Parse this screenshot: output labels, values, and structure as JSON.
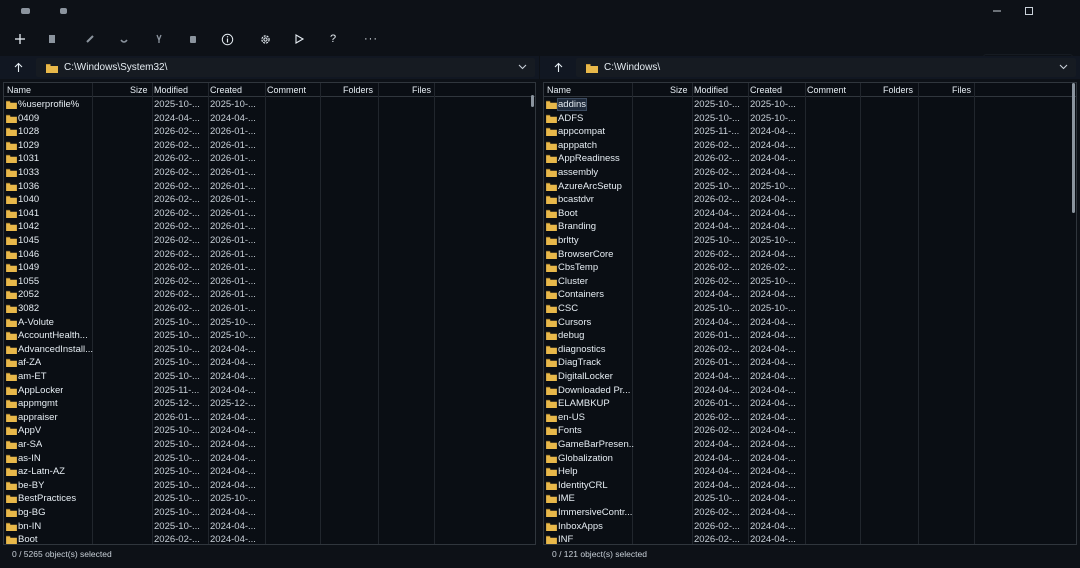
{
  "toolbar": {
    "items": [
      {
        "name": "new-icon",
        "glyph": "+"
      },
      {
        "name": "copy-icon",
        "glyph": "copy"
      },
      {
        "name": "edit-icon",
        "glyph": "edit"
      },
      {
        "name": "link-icon",
        "glyph": "link"
      },
      {
        "name": "cut-icon",
        "glyph": "cut"
      },
      {
        "name": "delete-icon",
        "glyph": "delete"
      },
      {
        "name": "info-icon",
        "glyph": "info"
      },
      {
        "name": "gear-icon",
        "glyph": "gear"
      },
      {
        "name": "play-icon",
        "glyph": "play"
      },
      {
        "name": "help-icon",
        "glyph": "?"
      },
      {
        "name": "more-icon",
        "glyph": "..."
      }
    ]
  },
  "left": {
    "path": "C:\\Windows\\System32\\",
    "columns": [
      "Name",
      "Size",
      "Modified",
      "Created",
      "Comment",
      "Folders",
      "Files"
    ],
    "rows": [
      {
        "name": "%userprofile%",
        "modified": "2025-10-...",
        "created": "2025-10-..."
      },
      {
        "name": "0409",
        "modified": "2024-04-...",
        "created": "2024-04-..."
      },
      {
        "name": "1028",
        "modified": "2026-02-...",
        "created": "2026-01-..."
      },
      {
        "name": "1029",
        "modified": "2026-02-...",
        "created": "2026-01-..."
      },
      {
        "name": "1031",
        "modified": "2026-02-...",
        "created": "2026-01-..."
      },
      {
        "name": "1033",
        "modified": "2026-02-...",
        "created": "2026-01-..."
      },
      {
        "name": "1036",
        "modified": "2026-02-...",
        "created": "2026-01-..."
      },
      {
        "name": "1040",
        "modified": "2026-02-...",
        "created": "2026-01-..."
      },
      {
        "name": "1041",
        "modified": "2026-02-...",
        "created": "2026-01-..."
      },
      {
        "name": "1042",
        "modified": "2026-02-...",
        "created": "2026-01-..."
      },
      {
        "name": "1045",
        "modified": "2026-02-...",
        "created": "2026-01-..."
      },
      {
        "name": "1046",
        "modified": "2026-02-...",
        "created": "2026-01-..."
      },
      {
        "name": "1049",
        "modified": "2026-02-...",
        "created": "2026-01-..."
      },
      {
        "name": "1055",
        "modified": "2026-02-...",
        "created": "2026-01-..."
      },
      {
        "name": "2052",
        "modified": "2026-02-...",
        "created": "2026-01-..."
      },
      {
        "name": "3082",
        "modified": "2026-02-...",
        "created": "2026-01-..."
      },
      {
        "name": "A-Volute",
        "modified": "2025-10-...",
        "created": "2025-10-..."
      },
      {
        "name": "AccountHealth...",
        "modified": "2025-10-...",
        "created": "2025-10-..."
      },
      {
        "name": "AdvancedInstall...",
        "modified": "2025-10-...",
        "created": "2024-04-..."
      },
      {
        "name": "af-ZA",
        "modified": "2025-10-...",
        "created": "2024-04-..."
      },
      {
        "name": "am-ET",
        "modified": "2025-10-...",
        "created": "2024-04-..."
      },
      {
        "name": "AppLocker",
        "modified": "2025-11-...",
        "created": "2024-04-..."
      },
      {
        "name": "appmgmt",
        "modified": "2025-12-...",
        "created": "2025-12-..."
      },
      {
        "name": "appraiser",
        "modified": "2026-01-...",
        "created": "2024-04-..."
      },
      {
        "name": "AppV",
        "modified": "2025-10-...",
        "created": "2024-04-..."
      },
      {
        "name": "ar-SA",
        "modified": "2025-10-...",
        "created": "2024-04-..."
      },
      {
        "name": "as-IN",
        "modified": "2025-10-...",
        "created": "2024-04-..."
      },
      {
        "name": "az-Latn-AZ",
        "modified": "2025-10-...",
        "created": "2024-04-..."
      },
      {
        "name": "be-BY",
        "modified": "2025-10-...",
        "created": "2024-04-..."
      },
      {
        "name": "BestPractices",
        "modified": "2025-10-...",
        "created": "2025-10-..."
      },
      {
        "name": "bg-BG",
        "modified": "2025-10-...",
        "created": "2024-04-..."
      },
      {
        "name": "bn-IN",
        "modified": "2025-10-...",
        "created": "2024-04-..."
      },
      {
        "name": "Boot",
        "modified": "2026-02-...",
        "created": "2024-04-..."
      }
    ],
    "status": "0 / 5265 object(s) selected"
  },
  "right": {
    "path": "C:\\Windows\\",
    "columns": [
      "Name",
      "Size",
      "Modified",
      "Created",
      "Comment",
      "Folders",
      "Files"
    ],
    "rows": [
      {
        "name": "addins",
        "modified": "2025-10-...",
        "created": "2025-10-..."
      },
      {
        "name": "ADFS",
        "modified": "2025-10-...",
        "created": "2025-10-..."
      },
      {
        "name": "appcompat",
        "modified": "2025-11-...",
        "created": "2024-04-..."
      },
      {
        "name": "apppatch",
        "modified": "2026-02-...",
        "created": "2024-04-..."
      },
      {
        "name": "AppReadiness",
        "modified": "2026-02-...",
        "created": "2024-04-..."
      },
      {
        "name": "assembly",
        "modified": "2026-02-...",
        "created": "2024-04-..."
      },
      {
        "name": "AzureArcSetup",
        "modified": "2025-10-...",
        "created": "2025-10-..."
      },
      {
        "name": "bcastdvr",
        "modified": "2026-02-...",
        "created": "2024-04-..."
      },
      {
        "name": "Boot",
        "modified": "2024-04-...",
        "created": "2024-04-..."
      },
      {
        "name": "Branding",
        "modified": "2024-04-...",
        "created": "2024-04-..."
      },
      {
        "name": "brltty",
        "modified": "2025-10-...",
        "created": "2025-10-..."
      },
      {
        "name": "BrowserCore",
        "modified": "2026-02-...",
        "created": "2024-04-..."
      },
      {
        "name": "CbsTemp",
        "modified": "2026-02-...",
        "created": "2026-02-..."
      },
      {
        "name": "Cluster",
        "modified": "2026-02-...",
        "created": "2025-10-..."
      },
      {
        "name": "Containers",
        "modified": "2024-04-...",
        "created": "2024-04-..."
      },
      {
        "name": "CSC",
        "modified": "2025-10-...",
        "created": "2025-10-..."
      },
      {
        "name": "Cursors",
        "modified": "2024-04-...",
        "created": "2024-04-..."
      },
      {
        "name": "debug",
        "modified": "2026-01-...",
        "created": "2024-04-..."
      },
      {
        "name": "diagnostics",
        "modified": "2026-02-...",
        "created": "2024-04-..."
      },
      {
        "name": "DiagTrack",
        "modified": "2026-01-...",
        "created": "2024-04-..."
      },
      {
        "name": "DigitalLocker",
        "modified": "2024-04-...",
        "created": "2024-04-..."
      },
      {
        "name": "Downloaded Pr...",
        "modified": "2024-04-...",
        "created": "2024-04-..."
      },
      {
        "name": "ELAMBKUP",
        "modified": "2026-01-...",
        "created": "2024-04-..."
      },
      {
        "name": "en-US",
        "modified": "2026-02-...",
        "created": "2024-04-..."
      },
      {
        "name": "Fonts",
        "modified": "2026-02-...",
        "created": "2024-04-..."
      },
      {
        "name": "GameBarPresen...",
        "modified": "2024-04-...",
        "created": "2024-04-..."
      },
      {
        "name": "Globalization",
        "modified": "2024-04-...",
        "created": "2024-04-..."
      },
      {
        "name": "Help",
        "modified": "2024-04-...",
        "created": "2024-04-..."
      },
      {
        "name": "IdentityCRL",
        "modified": "2024-04-...",
        "created": "2024-04-..."
      },
      {
        "name": "IME",
        "modified": "2025-10-...",
        "created": "2024-04-..."
      },
      {
        "name": "ImmersiveContr...",
        "modified": "2026-02-...",
        "created": "2024-04-..."
      },
      {
        "name": "InboxApps",
        "modified": "2026-02-...",
        "created": "2024-04-..."
      },
      {
        "name": "INF",
        "modified": "2026-02-...",
        "created": "2024-04-..."
      }
    ],
    "status": "0 / 121 object(s) selected"
  },
  "colors": {
    "background": "#0d1117",
    "grid": "#0a0e14",
    "folder": "#e8b84a",
    "text": "#e6edf3"
  }
}
